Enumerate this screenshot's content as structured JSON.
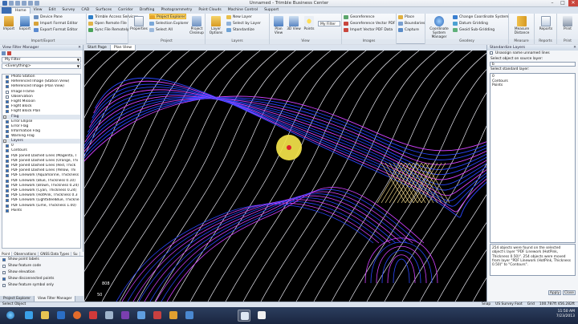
{
  "window": {
    "title": "Unnamed - Trimble Business Center",
    "minimize": "–",
    "maximize": "□",
    "close": "✕"
  },
  "ribbon_tabs": [
    "Home",
    "View",
    "Edit",
    "Survey",
    "CAD",
    "Surfaces",
    "Corridor",
    "Drafting",
    "Photogrammetry",
    "Point Clouds",
    "Machine Control",
    "Support"
  ],
  "ribbon": {
    "import_export": {
      "label": "Import/Export",
      "import": "Import",
      "export": "Export",
      "device_pane": "Device Pane",
      "import_format_editor": "Import Format Editor",
      "export_format_editor": "Export Format Editor",
      "trimble_access": "Trimble Access Services",
      "open_remote": "Open Remote File",
      "sync_remotely": "Sync File Remotely"
    },
    "project": {
      "label": "Project",
      "properties": "Properties",
      "project_explorer": "Project Explorer",
      "selection_explorer": "Selection Explorer",
      "select_all": "Select All",
      "project_cleanup": "Project Cleanup"
    },
    "layers": {
      "label": "Layers",
      "layer_options": "Layer Options",
      "new_layer": "New Layer",
      "select_by_layer": "Select by Layer",
      "standardize": "Standardize"
    },
    "view": {
      "label": "View",
      "plan_view": "Plan View",
      "view_3d": "3D View",
      "points": "Points",
      "my_filter": "My Filter"
    },
    "images": {
      "label": "Images",
      "georeference": "Georeference",
      "georeference_vector": "Georeference Vector PDF",
      "import_vector_pdf": "Import Vector PDF Data"
    },
    "cad": {
      "place": "Place",
      "boundaries": "Boundaries",
      "capture": "Capture"
    },
    "geodesy": {
      "label": "Geodesy",
      "coordinate_system_manager": "Coordinate System Manager",
      "change_coordinate_system": "Change Coordinate System",
      "datum_gridding": "Datum Gridding",
      "geoid_sub_gridding": "Geoid Sub-Gridding"
    },
    "measure": {
      "label": "Measure",
      "button": "Measure Distance"
    },
    "reports": {
      "label": "Reports",
      "button": "Reports"
    },
    "print": {
      "label": "Print",
      "button": "Print"
    }
  },
  "left_panel": {
    "title": "View Filter Manager",
    "filter_select": "My Filter",
    "everything_select": "<Everything>",
    "groups": [
      {
        "name": "",
        "items": [
          {
            "label": "Photo Station",
            "checked": true
          },
          {
            "label": "Referenced Image (Station View)",
            "checked": true
          },
          {
            "label": "Referenced Image (Plan View)",
            "checked": true
          },
          {
            "label": "Image Frame",
            "checked": false
          },
          {
            "label": "Observation",
            "checked": false
          },
          {
            "label": "Flight Mission",
            "checked": true
          },
          {
            "label": "Flight Block",
            "checked": true
          },
          {
            "label": "Flight Block Plan",
            "checked": true
          }
        ]
      },
      {
        "name": "Flag",
        "items": [
          {
            "label": "Error Ellipse",
            "checked": true
          },
          {
            "label": "Error Flag",
            "checked": true
          },
          {
            "label": "Information Flag",
            "checked": true
          },
          {
            "label": "Warning Flag",
            "checked": true
          }
        ]
      },
      {
        "name": "Layers",
        "items": [
          {
            "label": "0",
            "checked": true
          },
          {
            "label": "Contours",
            "checked": true
          },
          {
            "label": "PDF Joined Dashed Lines (Magenta, T",
            "checked": true
          },
          {
            "label": "PDF Joined Dashed Lines (Orange, Thi",
            "checked": true
          },
          {
            "label": "PDF Joined Dashed Lines (Red, Thick",
            "checked": true
          },
          {
            "label": "PDF Joined Dashed Lines (Yellow, Thi",
            "checked": true
          },
          {
            "label": "PDF Linework (Aquamarine, Thickness",
            "checked": true
          },
          {
            "label": "PDF Linework (Blue, Thickness 0.10)",
            "checked": true
          },
          {
            "label": "PDF Linework (Brown, Thickness 0.24)",
            "checked": true
          },
          {
            "label": "PDF Linework (Cyan, Thickness 0.24)",
            "checked": true
          },
          {
            "label": "PDF Linework (HotPink, Thickness 0.3",
            "checked": true
          },
          {
            "label": "PDF Linework (LightSteelBlue, Thickne",
            "checked": true
          },
          {
            "label": "PDF Linework (Lime, Thickness 1.00)",
            "checked": true
          },
          {
            "label": "Points",
            "checked": true
          }
        ]
      }
    ],
    "sub_tabs": [
      "Point",
      "Observations",
      "GNSS Data Types",
      "Su"
    ],
    "options": [
      {
        "label": "Show point labels",
        "checked": true
      },
      {
        "label": "Show feature code",
        "checked": false
      },
      {
        "label": "Show elevation",
        "checked": false
      },
      {
        "label": "Show disconnected points",
        "checked": true
      },
      {
        "label": "Show feature symbol only",
        "checked": false
      }
    ],
    "bottom_tabs": [
      "Project Explorer",
      "View Filter Manager"
    ]
  },
  "view_tabs": [
    "Start Page",
    "Plan View"
  ],
  "plan_view": {
    "labels": [
      "808",
      "50"
    ]
  },
  "right_panel": {
    "title": "Standardize Layers",
    "unassign_label": "Unassign name unnamed lines",
    "select_source": "Select object on source layer:",
    "source_value": "b",
    "select_standard": "Select standard layer:",
    "standard_layers": [
      "0",
      "Contours",
      "Points"
    ],
    "message": "254 objects were found on the selected object's layer \"PDF Linework (HotPink, Thickness 0.50)\". 254 objects were moved from layer \"PDF Linework (HotPink, Thickness 0.50)\" to \"Contours\".",
    "apply": "Apply",
    "close": "Close"
  },
  "status": {
    "left": "Select Object",
    "snap": "Snap",
    "units": "US Survey Foot",
    "grid": "Grid",
    "coords": "100.787ft 456.282ft"
  },
  "taskbar": {
    "time": "11:50 AM",
    "date": "7/23/2013"
  },
  "colors": {
    "cursor_halo": "#f3e34a",
    "cursor_dot": "#e0202a",
    "contour_white": "#e8e8f0",
    "contour_blue": "#2a46ff",
    "contour_magenta": "#d040ff"
  }
}
